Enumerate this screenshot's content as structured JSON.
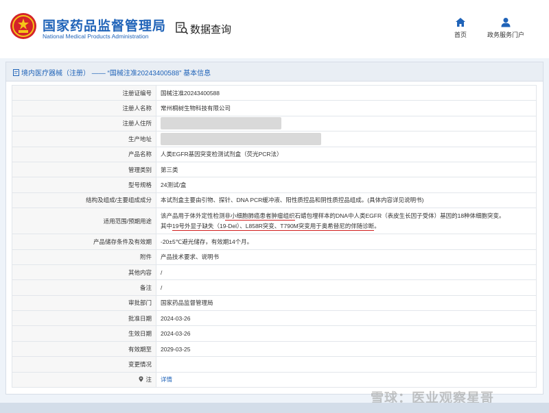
{
  "header": {
    "org_name_cn": "国家药品监督管理局",
    "org_name_en": "National Medical Products Administration",
    "query_title": "数据查询",
    "nav": {
      "home_label": "首页",
      "portal_label": "政务服务门户"
    }
  },
  "panel": {
    "title": "境内医疗器械（注册） —— “国械注准20243400588” 基本信息"
  },
  "record": {
    "reg_no": {
      "label": "注册证编号",
      "value": "国械注准20243400588"
    },
    "registrant": {
      "label": "注册人名称",
      "value": "常州桐树生物科技有限公司"
    },
    "registrant_address": {
      "label": "注册人住所",
      "value": ""
    },
    "production_address": {
      "label": "生产地址",
      "value": ""
    },
    "product_name": {
      "label": "产品名称",
      "value": "人类EGFR基因突变检测试剂盒（荧光PCR法）"
    },
    "category": {
      "label": "管理类别",
      "value": "第三类"
    },
    "model": {
      "label": "型号规格",
      "value": "24测试/盒"
    },
    "composition": {
      "label": "结构及组成/主要组成成分",
      "value": "本试剂盒主要由引物、探针、DNA PCR缓冲液、阳性质控品和阴性质控品组成。(具体内容详见说明书)"
    },
    "scope": {
      "label": "适用范围/预期用途",
      "line1_a": "该产品用于体外定性检测",
      "line1_b": "非小细胞肺癌患者肿瘤组织",
      "line1_c": "石蜡包埋样本的DNA中人类EGFR（表皮生长因子受体）基因的18种体细胞突变。",
      "line2_a": "其中",
      "line2_b": "19号外显子缺失（19-Del）、L858R突变、T790M突变用于奥希替尼的伴随诊断",
      "line2_c": "。"
    },
    "storage": {
      "label": "产品储存条件及有效期",
      "value": "-20±5℃避光储存，有效期14个月。"
    },
    "attachments": {
      "label": "附件",
      "value": "产品技术要求、说明书"
    },
    "other": {
      "label": "其他内容",
      "value": "/"
    },
    "remarks": {
      "label": "备注",
      "value": "/"
    },
    "approval_dept": {
      "label": "审批部门",
      "value": "国家药品监督管理局"
    },
    "approval_date": {
      "label": "批准日期",
      "value": "2024-03-26"
    },
    "effective_date": {
      "label": "生效日期",
      "value": "2024-03-26"
    },
    "expiry_date": {
      "label": "有效期至",
      "value": "2029-03-25"
    },
    "change": {
      "label": "变更情况",
      "value": ""
    },
    "detail": {
      "label": "注",
      "link": "详情"
    }
  },
  "watermark": "雪球：医业观察星哥",
  "colors": {
    "brand_blue": "#1f63b8",
    "highlight_red": "#d21d1d",
    "label_bg": "#f7f7f7",
    "panel_head_bg": "#e9eef4"
  }
}
